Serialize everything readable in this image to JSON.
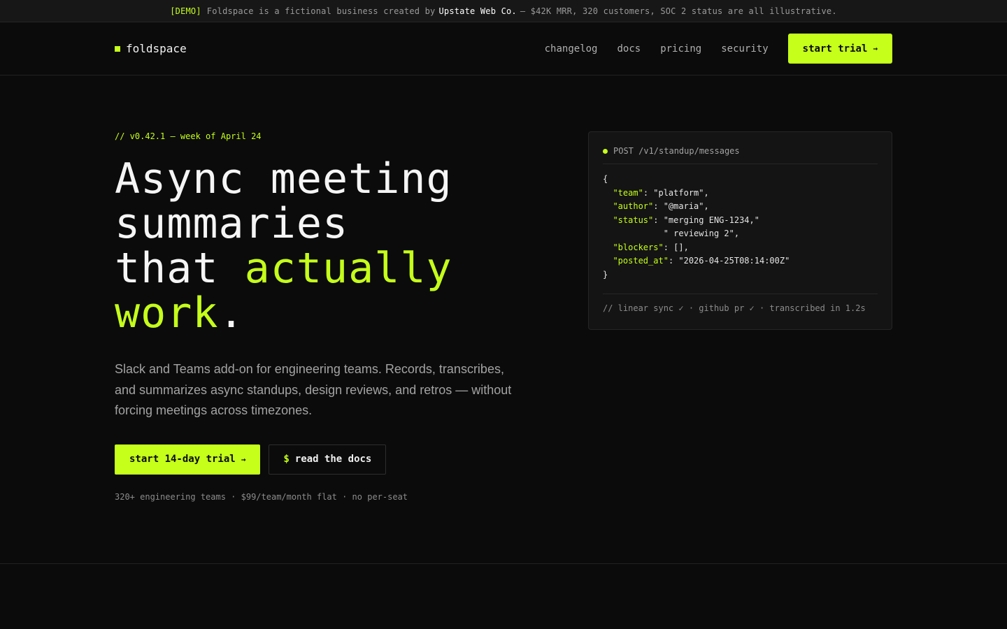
{
  "demo_bar": {
    "tag": "[DEMO]",
    "text_before": "Foldspace is a fictional business created by",
    "brand": "Upstate Web Co.",
    "text_after": "— $42K MRR, 320 customers, SOC 2 status are all illustrative."
  },
  "nav": {
    "logo": "foldspace",
    "links": [
      "changelog",
      "docs",
      "pricing",
      "security"
    ],
    "cta": "start trial",
    "cta_arrow": "→"
  },
  "hero": {
    "version": "// v0.42.1 — week of April 24",
    "headline_line1": "Async meeting",
    "headline_line2": "summaries",
    "headline_that": "that ",
    "headline_accent1": "actually",
    "headline_accent2": "work",
    "headline_period": ".",
    "subtext": "Slack and Teams add-on for engineering teams. Records, transcribes, and summarizes async standups, design reviews, and retros — without forcing meetings across timezones.",
    "primary_cta": "start 14-day trial",
    "primary_arrow": "→",
    "secondary_prefix": "$",
    "secondary_cta": "read the docs",
    "footnote": "320+ engineering teams · $99/team/month flat · no per-seat"
  },
  "code_card": {
    "endpoint": "POST /v1/standup/messages",
    "open_brace": "{",
    "lines": [
      {
        "key": "\"team\"",
        "value": ": \"platform\","
      },
      {
        "key": "\"author\"",
        "value": ": \"@maria\","
      },
      {
        "key": "\"status\"",
        "value": ": \"merging ENG-1234,\""
      },
      {
        "key": "",
        "value": "            \" reviewing 2\","
      },
      {
        "key": "\"blockers\"",
        "value": ": [],"
      },
      {
        "key": "\"posted_at\"",
        "value": ": \"2026-04-25T08:14:00Z\""
      }
    ],
    "close_brace": "}",
    "footer": "// linear sync ✓ · github pr ✓ · transcribed in 1.2s"
  },
  "colors": {
    "accent": "#c5ff1a",
    "background": "#0b0b0b"
  }
}
